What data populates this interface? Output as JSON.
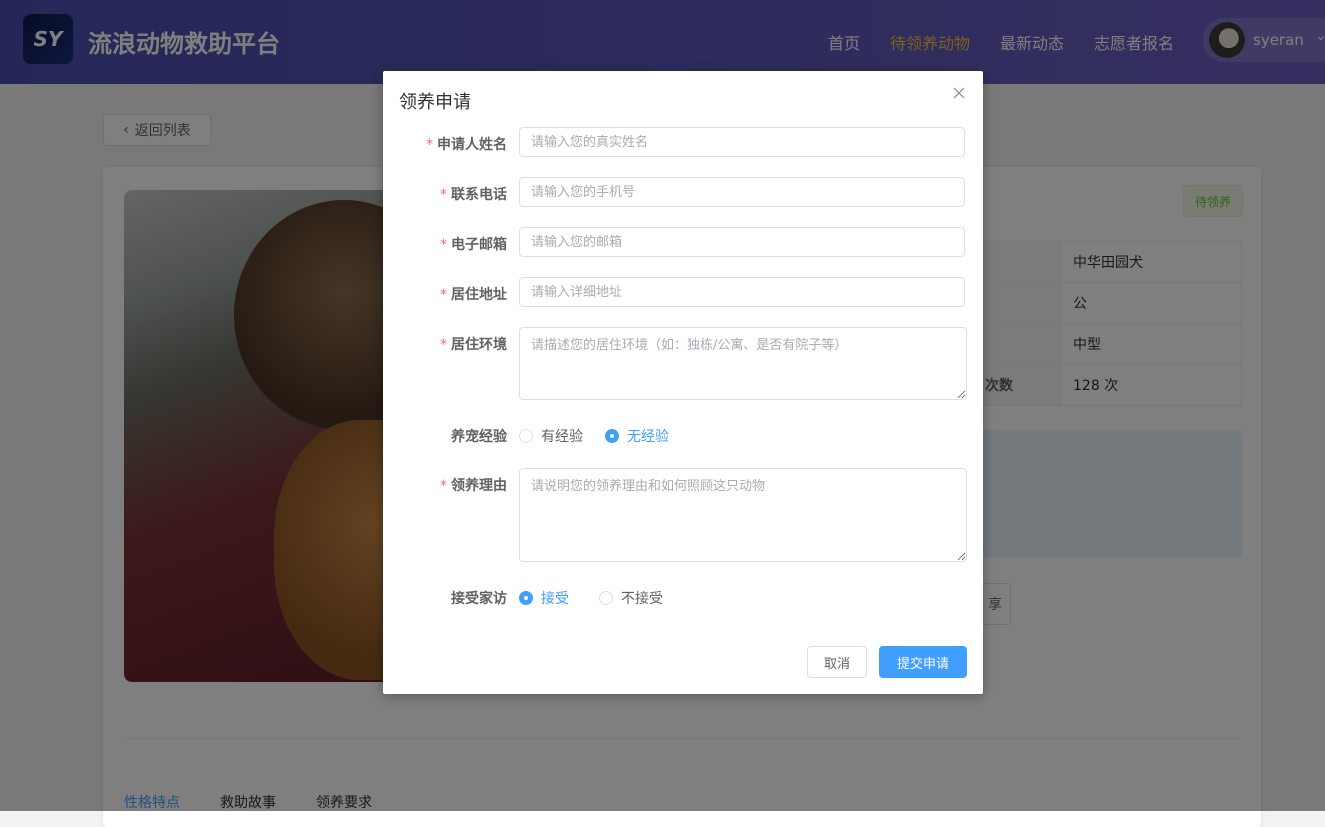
{
  "header": {
    "logo_text": "SY",
    "site_title": "流浪动物救助平台",
    "nav": [
      {
        "label": "首页"
      },
      {
        "label": "待领养动物"
      },
      {
        "label": "最新动态"
      },
      {
        "label": "志愿者报名"
      }
    ],
    "active_nav": "待领养动物",
    "user": {
      "name": "syeran"
    }
  },
  "page": {
    "back_label": "返回列表",
    "status_tag": "待领养",
    "info_rows": [
      {
        "key": "",
        "value": "中华田园犬"
      },
      {
        "key": "",
        "value": "公"
      },
      {
        "key": "",
        "value": "中型"
      },
      {
        "key": "次数",
        "value": "128 次"
      }
    ],
    "share_label": "享",
    "tabs": [
      {
        "label": "性格特点"
      },
      {
        "label": "救助故事"
      },
      {
        "label": "领养要求"
      }
    ]
  },
  "dialog": {
    "title": "领养申请",
    "fields": {
      "name": {
        "label": "申请人姓名",
        "placeholder": "请输入您的真实姓名",
        "required": true
      },
      "phone": {
        "label": "联系电话",
        "placeholder": "请输入您的手机号",
        "required": true
      },
      "email": {
        "label": "电子邮箱",
        "placeholder": "请输入您的邮箱",
        "required": true
      },
      "address": {
        "label": "居住地址",
        "placeholder": "请输入详细地址",
        "required": true
      },
      "environment": {
        "label": "居住环境",
        "placeholder": "请描述您的居住环境（如：独栋/公寓、是否有院子等）",
        "required": true
      },
      "experience": {
        "label": "养宠经验",
        "options": [
          "有经验",
          "无经验"
        ],
        "selected": "无经验"
      },
      "reason": {
        "label": "领养理由",
        "placeholder": "请说明您的领养理由和如何照顾这只动物",
        "required": true
      },
      "home_visit": {
        "label": "接受家访",
        "options": [
          "接受",
          "不接受"
        ],
        "selected": "接受"
      }
    },
    "required_mark": "*",
    "cancel_label": "取消",
    "submit_label": "提交申请"
  },
  "colors": {
    "primary": "#409eff",
    "required": "#f56c6c",
    "nav_active": "#f7c244",
    "tag_green": "#67c23a"
  },
  "icons": {
    "close": "close-icon",
    "back": "chevron-left-icon",
    "user_caret": "chevron-down-icon"
  }
}
